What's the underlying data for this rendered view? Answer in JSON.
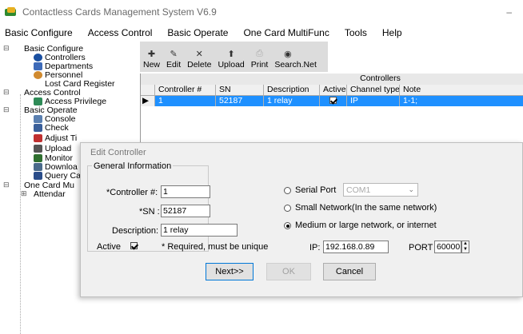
{
  "window": {
    "title": "Contactless Cards Management System  V6.9",
    "minimize": "–"
  },
  "menu": [
    "Basic Configure",
    "Access Control",
    "Basic Operate",
    "One Card MultiFunc",
    "Tools",
    "Help"
  ],
  "tree": {
    "basic_configure": "Basic Configure",
    "controllers": "Controllers",
    "departments": "Departments",
    "personnel": "Personnel",
    "lost_card": "Lost Card Register",
    "access_control": "Access Control",
    "access_privilege": "Access Privilege",
    "basic_operate": "Basic Operate",
    "console": "Console",
    "check": "Check",
    "adjust": "Adjust Ti",
    "upload": "Upload",
    "monitor": "Monitor",
    "download": "Downloa",
    "query": "Query Ca",
    "one_card": "One Card Mu",
    "attendance": "Attendar"
  },
  "toolbar": {
    "new": "New",
    "edit": "Edit",
    "delete": "Delete",
    "upload": "Upload",
    "print": "Print",
    "search": "Search",
    "net": ".Net"
  },
  "grid": {
    "caption": "Controllers",
    "headers": {
      "controller": "Controller #",
      "sn": "SN",
      "description": "Description",
      "active": "Active",
      "channel": "Channel type",
      "note": "Note"
    },
    "row": {
      "controller": "1",
      "sn": "52187",
      "description": "1 relay",
      "channel": "IP",
      "note": "1-1;"
    }
  },
  "dialog": {
    "title": "Edit Controller",
    "general": "General Information",
    "controller_label": "*Controller #:",
    "controller_value": "1",
    "sn_label": "*SN :",
    "sn_value": "52187",
    "desc_label": "Description:",
    "desc_value": "1 relay",
    "active_label": "Active",
    "required_note": "* Required, must be unique",
    "serial_label": "Serial Port",
    "serial_value": "COM1",
    "small_net": "Small Network(In the same network)",
    "medium_net": "Medium or large network, or internet",
    "ip_label": "IP:",
    "ip_value": "192.168.0.89",
    "port_label": "PORT",
    "port_value": "60000",
    "next": "Next>>",
    "ok": "OK",
    "cancel": "Cancel"
  }
}
